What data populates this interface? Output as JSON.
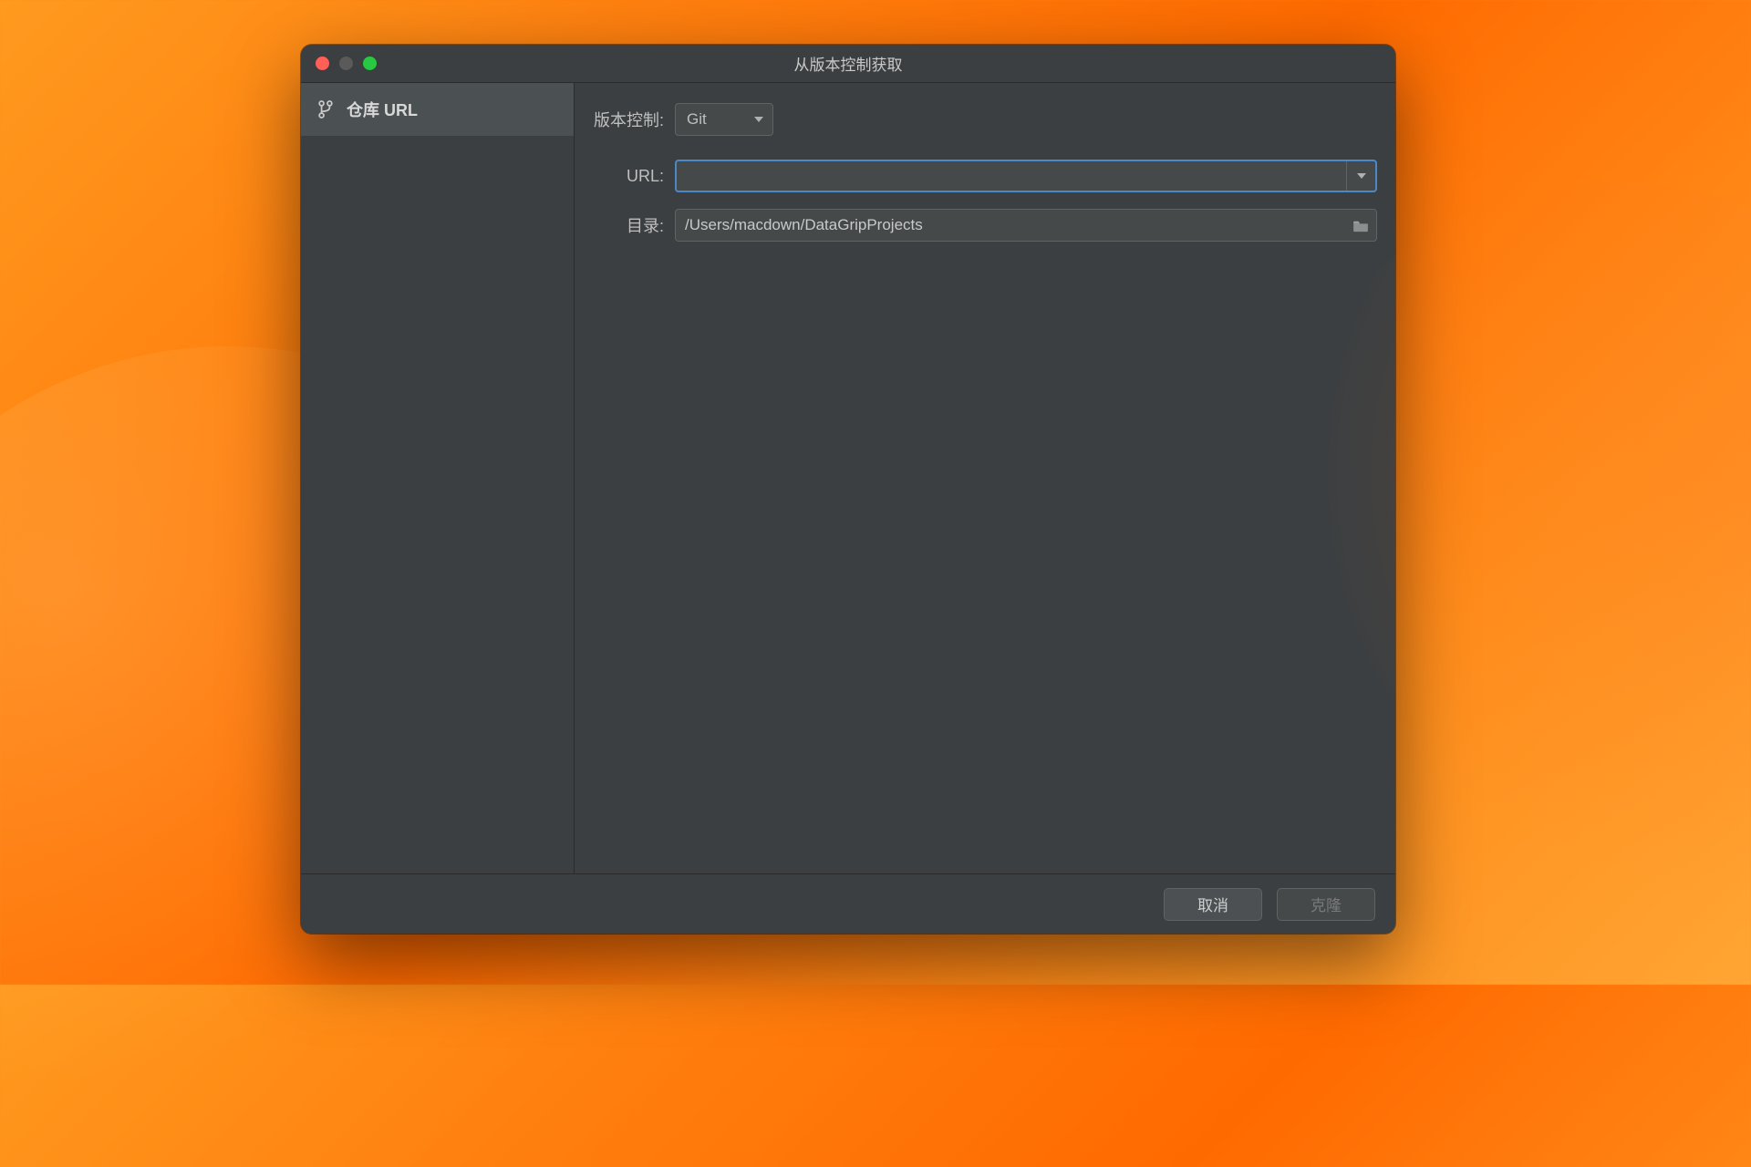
{
  "window": {
    "title": "从版本控制获取"
  },
  "sidebar": {
    "repo_url_label": "仓库 URL"
  },
  "form": {
    "vcs_label": "版本控制:",
    "vcs_value": "Git",
    "url_label": "URL:",
    "url_value": "",
    "dir_label": "目录:",
    "dir_value": "/Users/macdown/DataGripProjects"
  },
  "buttons": {
    "cancel": "取消",
    "clone": "克隆"
  }
}
